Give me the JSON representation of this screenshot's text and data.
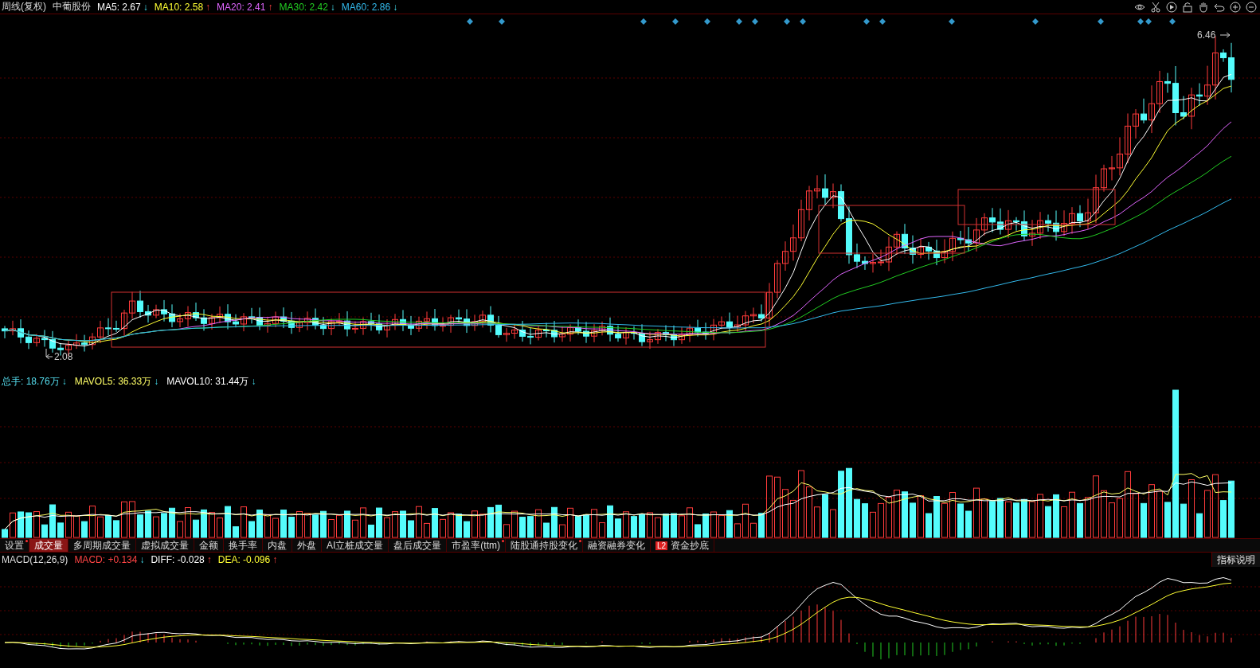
{
  "header": {
    "period": "周线(复权)",
    "stock": "中葡股份",
    "indicators": [
      {
        "label": "MA5: 2.67",
        "arrow": "↓",
        "rising": false,
        "color": "#ffffff"
      },
      {
        "label": "MA10: 2.58",
        "arrow": "↑",
        "rising": true,
        "color": "#ffff33"
      },
      {
        "label": "MA20: 2.41",
        "arrow": "↑",
        "rising": true,
        "color": "#e066ff"
      },
      {
        "label": "MA30: 2.42",
        "arrow": "↓",
        "rising": false,
        "color": "#22cc22"
      },
      {
        "label": "MA60: 2.86",
        "arrow": "↓",
        "rising": false,
        "color": "#33bbee"
      }
    ]
  },
  "main_chart": {
    "high_label": "6.46",
    "low_label": "2.08"
  },
  "volume": {
    "indicators": [
      {
        "label": "总手: 18.76万",
        "arrow": "↓",
        "rising": false,
        "color": "#55ddee"
      },
      {
        "label": "MAVOL5: 36.33万",
        "arrow": "↓",
        "rising": false,
        "color": "#ffff66"
      },
      {
        "label": "MAVOL10: 31.44万",
        "arrow": "↓",
        "rising": false,
        "color": "#ffffff"
      }
    ]
  },
  "tabs": [
    {
      "label": "设置",
      "selected": false,
      "marked": true
    },
    {
      "label": "成交量",
      "selected": true,
      "marked": false
    },
    {
      "label": "多周期成交量",
      "selected": false,
      "marked": false
    },
    {
      "label": "虚拟成交量",
      "selected": false,
      "marked": false
    },
    {
      "label": "金额",
      "selected": false,
      "marked": false
    },
    {
      "label": "换手率",
      "selected": false,
      "marked": false
    },
    {
      "label": "内盘",
      "selected": false,
      "marked": false
    },
    {
      "label": "外盘",
      "selected": false,
      "marked": false
    },
    {
      "label": "AI立桩成交量",
      "selected": false,
      "marked": false
    },
    {
      "label": "盘后成交量",
      "selected": false,
      "marked": false
    },
    {
      "label": "市盈率(ttm)",
      "selected": false,
      "marked": true
    },
    {
      "label": "陆股通持股变化",
      "selected": false,
      "marked": true
    },
    {
      "label": "融资融券变化",
      "selected": false,
      "marked": false
    },
    {
      "label": "资金抄底",
      "selected": false,
      "marked": false,
      "badge": "L2"
    }
  ],
  "macd": {
    "indicators": [
      {
        "label": "MACD(12,26,9)",
        "color": "#dddddd"
      },
      {
        "label": "MACD: +0.134",
        "arrow": "↓",
        "rising": false,
        "color": "#ff4444"
      },
      {
        "label": "DIFF: -0.028",
        "arrow": "↑",
        "rising": true,
        "color": "#ffffff"
      },
      {
        "label": "DEA: -0.096",
        "arrow": "↑",
        "rising": true,
        "color": "#ffff33"
      }
    ],
    "help_button": "指标说明"
  }
}
